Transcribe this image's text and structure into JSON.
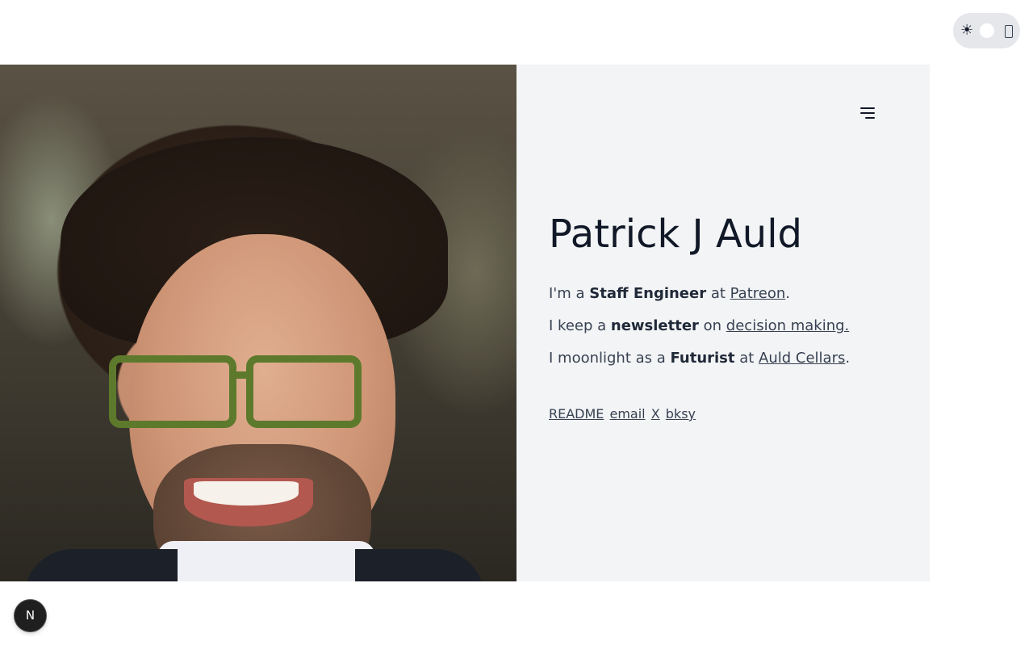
{
  "theme_toggle": {
    "sun_icon": "☀",
    "moon_icon": "moon-icon"
  },
  "profile": {
    "name": "Patrick J Auld",
    "photo_alt": "Patrick J Auld portrait"
  },
  "bio": {
    "line1": {
      "prefix": "I'm a ",
      "role": "Staff Engineer",
      "mid": " at ",
      "link": "Patreon",
      "suffix": "."
    },
    "line2": {
      "prefix": "I keep a ",
      "role": "newsletter",
      "mid": " on ",
      "link": "decision making.",
      "suffix": ""
    },
    "line3": {
      "prefix": "I moonlight as a ",
      "role": "Futurist",
      "mid": " at ",
      "link": "Auld Cellars",
      "suffix": "."
    }
  },
  "links": {
    "readme": "README",
    "email": "email",
    "x": "X",
    "bksy": "bksy"
  },
  "badge": {
    "label": "N"
  }
}
